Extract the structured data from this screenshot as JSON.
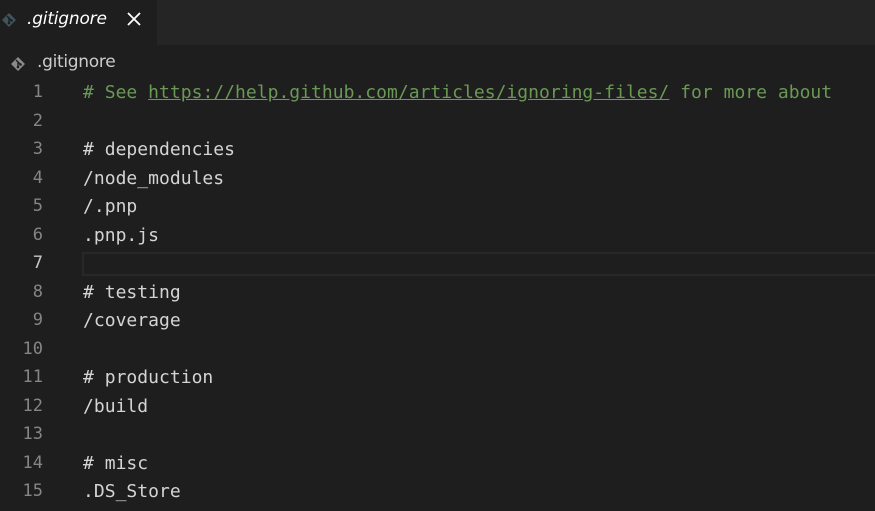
{
  "tab": {
    "title": ".gitignore",
    "icon": "git-file-icon",
    "close_icon": "close-icon"
  },
  "breadcrumb": {
    "label": ".gitignore",
    "icon": "git-file-icon"
  },
  "editor": {
    "current_line": 7,
    "lines": [
      {
        "num": "1",
        "prefix": "# See ",
        "link": "https://help.github.com/articles/ignoring-files/",
        "suffix": " for more about",
        "type": "comment"
      },
      {
        "num": "2",
        "text": "",
        "type": "plain"
      },
      {
        "num": "3",
        "text": "# dependencies",
        "type": "comment"
      },
      {
        "num": "4",
        "text": "/node_modules",
        "type": "plain"
      },
      {
        "num": "5",
        "text": "/.pnp",
        "type": "plain"
      },
      {
        "num": "6",
        "text": ".pnp.js",
        "type": "plain"
      },
      {
        "num": "7",
        "text": "",
        "type": "plain"
      },
      {
        "num": "8",
        "text": "# testing",
        "type": "comment"
      },
      {
        "num": "9",
        "text": "/coverage",
        "type": "plain"
      },
      {
        "num": "10",
        "text": "",
        "type": "plain"
      },
      {
        "num": "11",
        "text": "# production",
        "type": "comment"
      },
      {
        "num": "12",
        "text": "/build",
        "type": "plain"
      },
      {
        "num": "13",
        "text": "",
        "type": "plain"
      },
      {
        "num": "14",
        "text": "# misc",
        "type": "comment"
      },
      {
        "num": "15",
        "text": ".DS_Store",
        "type": "plain"
      }
    ]
  },
  "colors": {
    "background": "#1e1e1e",
    "tabbar": "#252526",
    "comment": "#6a9955",
    "text": "#d4d4d4",
    "line_number": "#858585"
  }
}
